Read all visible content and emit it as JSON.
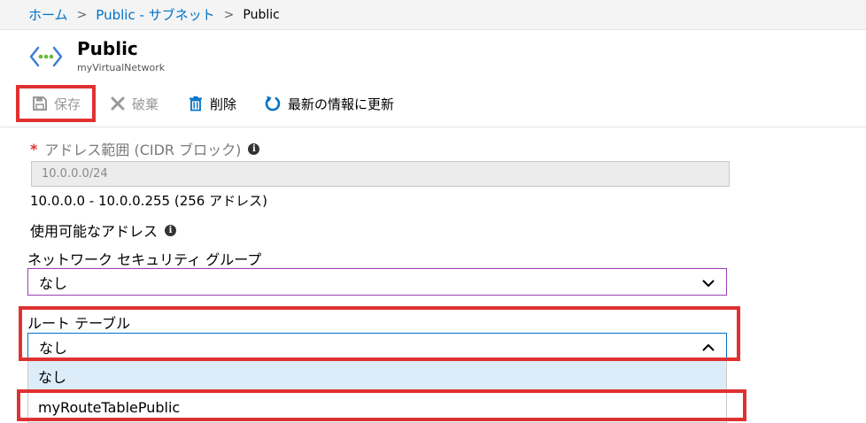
{
  "breadcrumb": {
    "home": "ホーム",
    "subnets": "Public - サブネット",
    "current": "Public",
    "separator": ">"
  },
  "header": {
    "icon": "virtual-network-icon",
    "title": "Public",
    "subtitle": "myVirtualNetwork"
  },
  "toolbar": {
    "save_label": "保存",
    "discard_label": "破棄",
    "delete_label": "削除",
    "refresh_label": "最新の情報に更新"
  },
  "form": {
    "required_mark": "*",
    "address_range_label": "アドレス範囲 (CIDR ブロック)",
    "address_range_value": "10.0.0.0/24",
    "address_range_summary": "10.0.0.0 - 10.0.0.255 (256 アドレス)",
    "available_addresses_label": "使用可能なアドレス",
    "info_glyph": "i",
    "nsg_label": "ネットワーク セキュリティ グループ",
    "nsg_value": "なし",
    "route_table_label": "ルート テーブル",
    "route_table_value": "なし",
    "route_table_options": [
      "なし",
      "myRouteTablePublic"
    ]
  },
  "colors": {
    "link": "#0072c6",
    "highlight": "#e03131",
    "nsg_border": "#9b3fb5",
    "focus_border": "#0072c6",
    "option_selected_bg": "#dcecf9"
  }
}
